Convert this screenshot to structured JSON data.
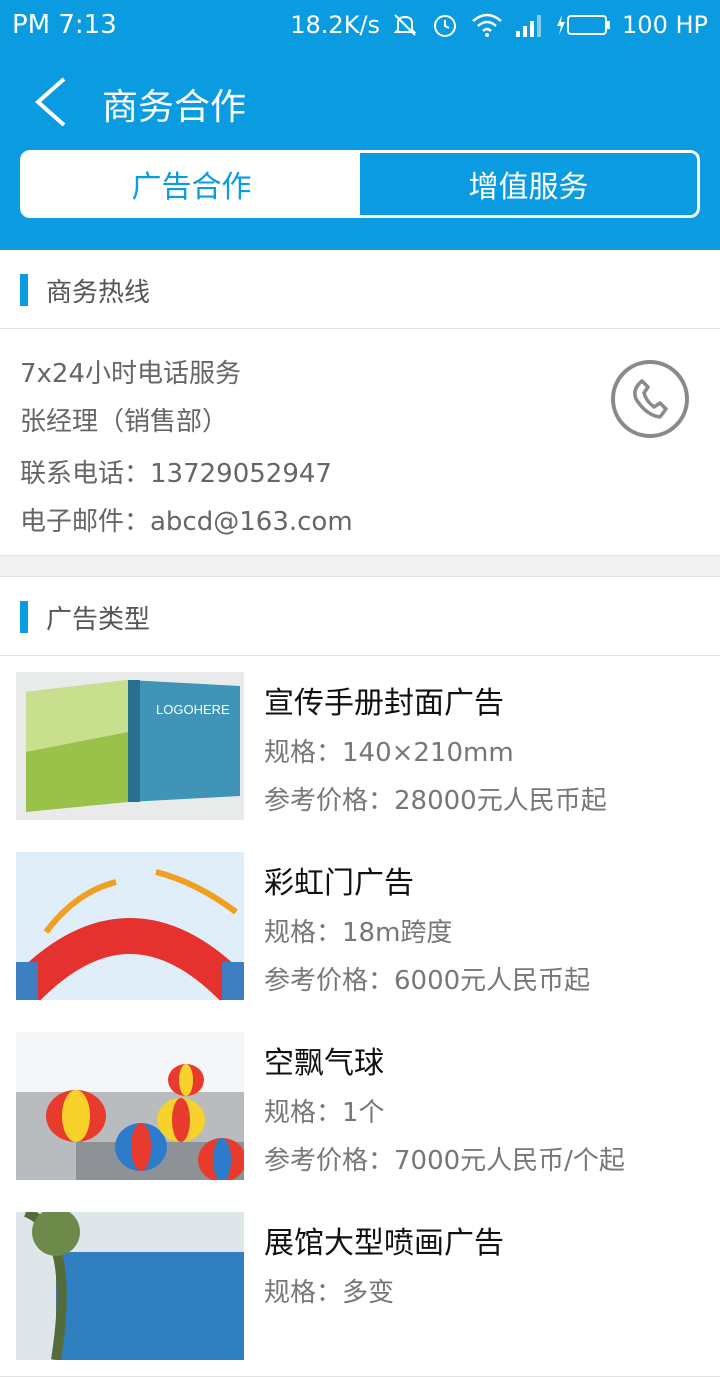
{
  "status_bar": {
    "time": "PM 7:13",
    "speed": "18.2K/s",
    "battery": "100 HP"
  },
  "nav": {
    "title": "商务合作"
  },
  "tabs": [
    {
      "label": "广告合作",
      "active": true
    },
    {
      "label": "增值服务",
      "active": false
    }
  ],
  "hotline": {
    "header": "商务热线",
    "lines": [
      "7x24小时电话服务",
      "张经理（销售部）",
      "联系电话：13729052947",
      "电子邮件：abcd@163.com"
    ]
  },
  "ad_types": {
    "header": "广告类型",
    "items": [
      {
        "title": "宣传手册封面广告",
        "spec": "规格：140×210mm",
        "price": "参考价格：28000元人民币起",
        "thumb_text": "LOGOHERE"
      },
      {
        "title": "彩虹门广告",
        "spec": "规格：18m跨度",
        "price": "参考价格：6000元人民币起"
      },
      {
        "title": "空飘气球",
        "spec": "规格：1个",
        "price": "参考价格：7000元人民币/个起"
      },
      {
        "title": "展馆大型喷画广告",
        "spec": "规格：多变",
        "price": ""
      }
    ]
  },
  "colors": {
    "accent": "#0b9be0",
    "background": "#f2f2f2"
  }
}
